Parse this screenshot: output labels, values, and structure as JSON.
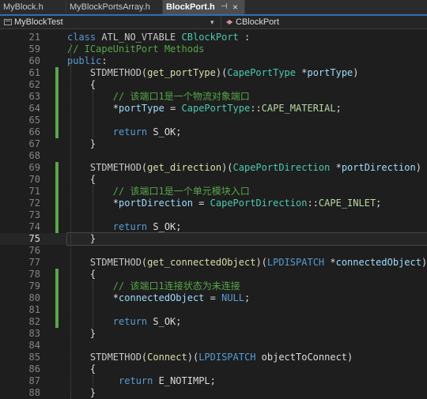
{
  "tabs": [
    {
      "label": "MyBlock.h",
      "active": false
    },
    {
      "label": "MyBlockPortsArray.h",
      "active": false
    },
    {
      "label": "BlockPort.h",
      "active": true
    }
  ],
  "tab_controls": {
    "pin": "⊣",
    "close": "×"
  },
  "navbar": {
    "project": "MyBlockTest",
    "scope": "CBlockPort"
  },
  "colors": {
    "keyword": "#569cd6",
    "type": "#4ec9b0",
    "function": "#dcdcaa",
    "parameter": "#9cdcfe",
    "comment": "#57a64a",
    "enum_value": "#b8d7a3",
    "change_marker": "#57a64a",
    "active_tab_accent": "#2f6fb8"
  },
  "lines": [
    {
      "num": "21",
      "tokens": [
        {
          "t": "class ",
          "c": "kw"
        },
        {
          "t": "ATL_NO_VTABLE ",
          "c": "mc"
        },
        {
          "t": "CBlockPort",
          "c": "ty"
        },
        {
          "t": " :",
          "c": "pl"
        }
      ]
    },
    {
      "num": "59",
      "tokens": [
        {
          "t": "// ICapeUnitPort Methods",
          "c": "cm"
        }
      ]
    },
    {
      "num": "60",
      "tokens": [
        {
          "t": "public",
          "c": "kw"
        },
        {
          "t": ":",
          "c": "pl"
        }
      ]
    },
    {
      "num": "61",
      "changed": true,
      "tokens": [
        {
          "t": "    STDMETHOD",
          "c": "mc"
        },
        {
          "t": "(",
          "c": "pl"
        },
        {
          "t": "get_portType",
          "c": "fn"
        },
        {
          "t": ")(",
          "c": "pl"
        },
        {
          "t": "CapePortType",
          "c": "ty"
        },
        {
          "t": " *",
          "c": "pl"
        },
        {
          "t": "portType",
          "c": "pm"
        },
        {
          "t": ")",
          "c": "pl"
        }
      ]
    },
    {
      "num": "62",
      "changed": true,
      "tokens": [
        {
          "t": "    {",
          "c": "pl"
        }
      ]
    },
    {
      "num": "63",
      "changed": true,
      "tokens": [
        {
          "t": "        // 该端口1是一个物流对象端口",
          "c": "cm"
        }
      ]
    },
    {
      "num": "64",
      "changed": true,
      "tokens": [
        {
          "t": "        *",
          "c": "pl"
        },
        {
          "t": "portType",
          "c": "pm"
        },
        {
          "t": " = ",
          "c": "pl"
        },
        {
          "t": "CapePortType",
          "c": "ty"
        },
        {
          "t": "::",
          "c": "pl"
        },
        {
          "t": "CAPE_MATERIAL",
          "c": "en"
        },
        {
          "t": ";",
          "c": "pl"
        }
      ]
    },
    {
      "num": "65",
      "changed": true,
      "tokens": []
    },
    {
      "num": "66",
      "changed": true,
      "tokens": [
        {
          "t": "        ",
          "c": "pl"
        },
        {
          "t": "return",
          "c": "kw"
        },
        {
          "t": " S_OK;",
          "c": "pl"
        }
      ]
    },
    {
      "num": "67",
      "tokens": [
        {
          "t": "    }",
          "c": "pl"
        }
      ]
    },
    {
      "num": "68",
      "tokens": []
    },
    {
      "num": "69",
      "changed": true,
      "tokens": [
        {
          "t": "    STDMETHOD",
          "c": "mc"
        },
        {
          "t": "(",
          "c": "pl"
        },
        {
          "t": "get_direction",
          "c": "fn"
        },
        {
          "t": ")(",
          "c": "pl"
        },
        {
          "t": "CapePortDirection",
          "c": "ty"
        },
        {
          "t": " *",
          "c": "pl"
        },
        {
          "t": "portDirection",
          "c": "pm"
        },
        {
          "t": ")",
          "c": "pl"
        }
      ]
    },
    {
      "num": "70",
      "changed": true,
      "tokens": [
        {
          "t": "    {",
          "c": "pl"
        }
      ]
    },
    {
      "num": "71",
      "changed": true,
      "tokens": [
        {
          "t": "        // 该端口1是一个单元模块入口",
          "c": "cm"
        }
      ]
    },
    {
      "num": "72",
      "changed": true,
      "tokens": [
        {
          "t": "        *",
          "c": "pl"
        },
        {
          "t": "portDirection",
          "c": "pm"
        },
        {
          "t": " = ",
          "c": "pl"
        },
        {
          "t": "CapePortDirection",
          "c": "ty"
        },
        {
          "t": "::",
          "c": "pl"
        },
        {
          "t": "CAPE_INLET",
          "c": "en"
        },
        {
          "t": ";",
          "c": "pl"
        }
      ]
    },
    {
      "num": "73",
      "changed": true,
      "tokens": []
    },
    {
      "num": "74",
      "changed": true,
      "tokens": [
        {
          "t": "        ",
          "c": "pl"
        },
        {
          "t": "return",
          "c": "kw"
        },
        {
          "t": " S_OK;",
          "c": "pl"
        }
      ]
    },
    {
      "num": "75",
      "current": true,
      "tokens": [
        {
          "t": "    }",
          "c": "pl"
        }
      ]
    },
    {
      "num": "76",
      "tokens": []
    },
    {
      "num": "77",
      "tokens": [
        {
          "t": "    STDMETHOD",
          "c": "mc"
        },
        {
          "t": "(",
          "c": "pl"
        },
        {
          "t": "get_connectedObject",
          "c": "fn"
        },
        {
          "t": ")(",
          "c": "pl"
        },
        {
          "t": "LPDISPATCH",
          "c": "kw"
        },
        {
          "t": " *",
          "c": "pl"
        },
        {
          "t": "connectedObject",
          "c": "pm"
        },
        {
          "t": ")",
          "c": "pl"
        }
      ]
    },
    {
      "num": "78",
      "changed": true,
      "tokens": [
        {
          "t": "    {",
          "c": "pl"
        }
      ]
    },
    {
      "num": "79",
      "changed": true,
      "tokens": [
        {
          "t": "        // 该端口1连接状态为未连接",
          "c": "cm"
        }
      ]
    },
    {
      "num": "80",
      "changed": true,
      "tokens": [
        {
          "t": "        *",
          "c": "pl"
        },
        {
          "t": "connectedObject",
          "c": "pm"
        },
        {
          "t": " = ",
          "c": "pl"
        },
        {
          "t": "NULL",
          "c": "kw"
        },
        {
          "t": ";",
          "c": "pl"
        }
      ]
    },
    {
      "num": "81",
      "changed": true,
      "tokens": []
    },
    {
      "num": "82",
      "changed": true,
      "tokens": [
        {
          "t": "        ",
          "c": "pl"
        },
        {
          "t": "return",
          "c": "kw"
        },
        {
          "t": " S_OK;",
          "c": "pl"
        }
      ]
    },
    {
      "num": "83",
      "tokens": [
        {
          "t": "    }",
          "c": "pl"
        }
      ]
    },
    {
      "num": "84",
      "tokens": []
    },
    {
      "num": "85",
      "tokens": [
        {
          "t": "    STDMETHOD",
          "c": "mc"
        },
        {
          "t": "(",
          "c": "pl"
        },
        {
          "t": "Connect",
          "c": "fn"
        },
        {
          "t": ")(",
          "c": "pl"
        },
        {
          "t": "LPDISPATCH",
          "c": "kw"
        },
        {
          "t": " objectToConnect)",
          "c": "pl"
        }
      ]
    },
    {
      "num": "86",
      "tokens": [
        {
          "t": "    {",
          "c": "pl"
        }
      ]
    },
    {
      "num": "87",
      "tokens": [
        {
          "t": "         ",
          "c": "pl"
        },
        {
          "t": "return",
          "c": "kw"
        },
        {
          "t": " E_NOTIMPL;",
          "c": "pl"
        }
      ]
    },
    {
      "num": "88",
      "tokens": [
        {
          "t": "    }",
          "c": "pl"
        }
      ]
    }
  ]
}
